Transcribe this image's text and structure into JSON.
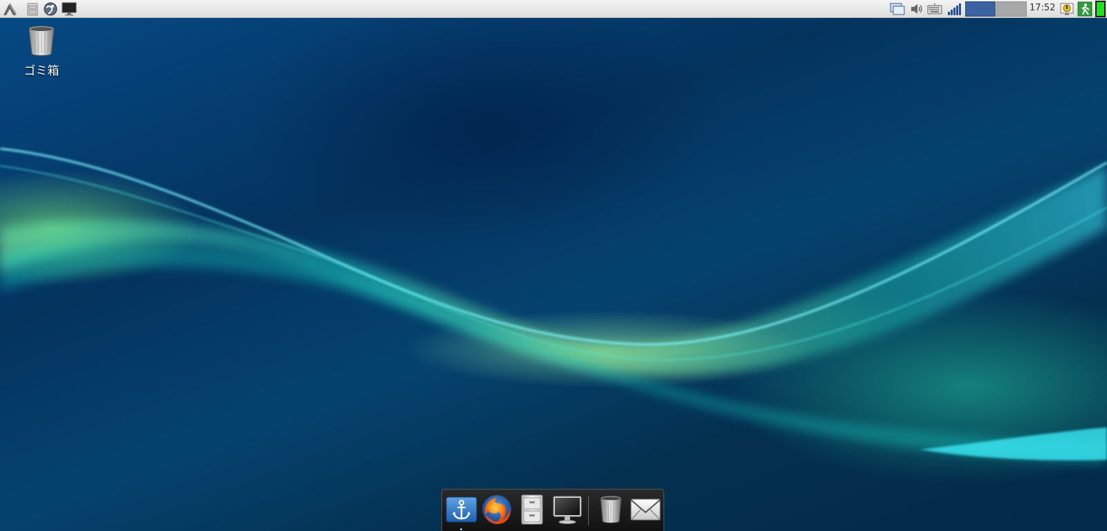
{
  "top_panel": {
    "launchers": [
      {
        "icon": "app-menu-icon"
      },
      {
        "icon": "file-manager-icon"
      },
      {
        "icon": "web-browser-icon"
      },
      {
        "icon": "terminal-icon"
      }
    ],
    "tray": [
      {
        "icon": "window-list-icon"
      },
      {
        "icon": "volume-icon"
      },
      {
        "icon": "keyboard-icon"
      },
      {
        "icon": "network-signal-icon"
      }
    ],
    "workspaces": [
      {
        "name": "workspace-1",
        "active": true,
        "color": "#3a63a0"
      },
      {
        "name": "workspace-2",
        "active": false,
        "color": "#a8a8a8"
      }
    ],
    "clock": "17:52",
    "right_icons": [
      {
        "icon": "update-notifier-icon"
      },
      {
        "icon": "logout-icon"
      },
      {
        "icon": "battery-icon"
      }
    ]
  },
  "desktop": {
    "icons": [
      {
        "label": "ゴミ箱",
        "icon": "trash-icon"
      }
    ]
  },
  "dock": {
    "items": [
      {
        "icon": "dock-anchor-icon",
        "name": "dock-settings",
        "running": true
      },
      {
        "icon": "firefox-icon",
        "name": "firefox"
      },
      {
        "icon": "file-cabinet-icon",
        "name": "file-manager"
      },
      {
        "icon": "monitor-icon",
        "name": "terminal"
      },
      {
        "icon": "trash-icon",
        "name": "trash"
      },
      {
        "icon": "mail-icon",
        "name": "mail"
      }
    ]
  }
}
